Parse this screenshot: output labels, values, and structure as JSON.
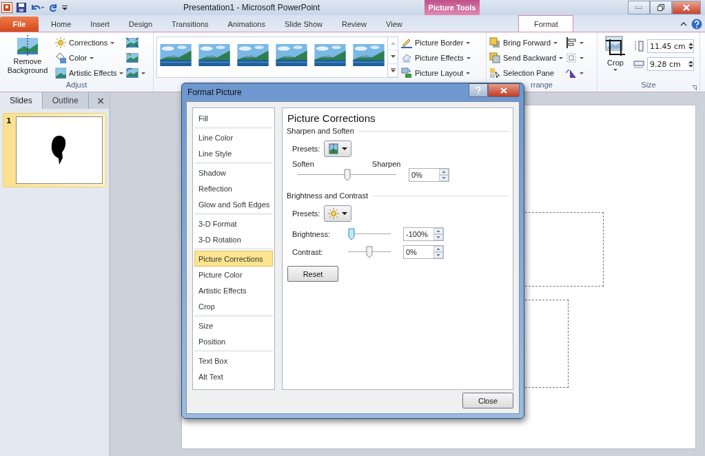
{
  "title_bar": {
    "title": "Presentation1  -  Microsoft PowerPoint",
    "context_tab": "Picture Tools"
  },
  "ribbon_tabs": [
    {
      "label": "File",
      "kind": "file",
      "selected": false
    },
    {
      "label": "Home",
      "kind": "tab",
      "selected": false
    },
    {
      "label": "Insert",
      "kind": "tab",
      "selected": false
    },
    {
      "label": "Design",
      "kind": "tab",
      "selected": false
    },
    {
      "label": "Transitions",
      "kind": "tab",
      "selected": false
    },
    {
      "label": "Animations",
      "kind": "tab",
      "selected": false
    },
    {
      "label": "Slide Show",
      "kind": "tab",
      "selected": false
    },
    {
      "label": "Review",
      "kind": "tab",
      "selected": false
    },
    {
      "label": "View",
      "kind": "tab",
      "selected": false
    },
    {
      "label": "Format",
      "kind": "context",
      "selected": true
    }
  ],
  "adjust_group": {
    "big_button": "Remove Background",
    "commands": [
      "Corrections",
      "Color",
      "Artistic Effects"
    ],
    "label": "Adjust"
  },
  "styles_group": {
    "gallery": [
      {
        "kind": "picture"
      },
      {
        "kind": "picture"
      },
      {
        "kind": "picture"
      },
      {
        "kind": "picture"
      },
      {
        "kind": "picture"
      },
      {
        "kind": "picture"
      }
    ],
    "commands": [
      "Picture Border",
      "Picture Effects",
      "Picture Layout"
    ]
  },
  "arrange_group": {
    "commands": [
      "Bring Forward",
      "Send Backward",
      "Selection Pane"
    ],
    "label": "rrange"
  },
  "size_group": {
    "crop": "Crop",
    "height": "11.45 cm",
    "width": "9.28 cm",
    "label": "Size"
  },
  "slides_pane": {
    "tabs": [
      {
        "label": "Slides",
        "selected": true
      },
      {
        "label": "Outline",
        "selected": false
      }
    ],
    "close": "×",
    "slides": [
      {
        "number": "1",
        "selected": true
      }
    ]
  },
  "dialog": {
    "title": "Format Picture",
    "category_groups": [
      {
        "items": [
          {
            "label": "Fill",
            "selected": false
          }
        ]
      },
      {
        "items": [
          {
            "label": "Line Color",
            "selected": false
          },
          {
            "label": "Line Style",
            "selected": false
          }
        ]
      },
      {
        "items": [
          {
            "label": "Shadow",
            "selected": false
          },
          {
            "label": "Reflection",
            "selected": false
          },
          {
            "label": "Glow and Soft Edges",
            "selected": false
          }
        ]
      },
      {
        "items": [
          {
            "label": "3-D Format",
            "selected": false
          },
          {
            "label": "3-D Rotation",
            "selected": false
          }
        ]
      },
      {
        "items": [
          {
            "label": "Picture Corrections",
            "selected": true
          },
          {
            "label": "Picture Color",
            "selected": false
          },
          {
            "label": "Artistic Effects",
            "selected": false
          },
          {
            "label": "Crop",
            "selected": false
          }
        ]
      },
      {
        "items": [
          {
            "label": "Size",
            "selected": false
          },
          {
            "label": "Position",
            "selected": false
          }
        ]
      },
      {
        "items": [
          {
            "label": "Text Box",
            "selected": false
          },
          {
            "label": "Alt Text",
            "selected": false
          }
        ]
      }
    ],
    "heading": "Picture Corrections",
    "sharpen": {
      "title": "Sharpen and Soften",
      "presets_label": "Presets:",
      "left_label": "Soften",
      "right_label": "Sharpen",
      "level": 0.5,
      "value": "0%"
    },
    "brightness": {
      "title": "Brightness and Contrast",
      "presets_label": "Presets:",
      "sliders": [
        {
          "label": "Brightness:",
          "level": 0,
          "value": "-100%",
          "active": true
        },
        {
          "label": "Contrast:",
          "level": 0.5,
          "value": "0%",
          "active": false
        }
      ]
    },
    "reset": "Reset",
    "close": "Close"
  }
}
